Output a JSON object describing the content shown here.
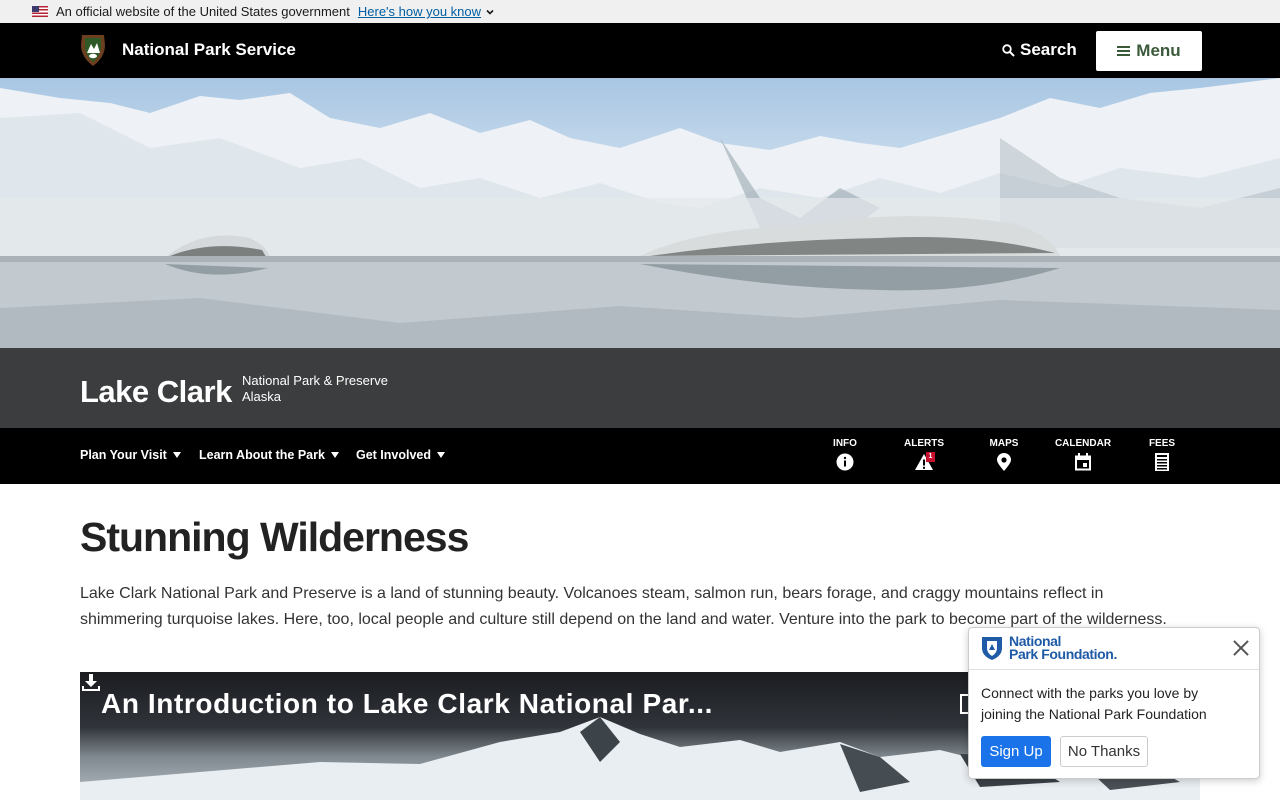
{
  "gov_banner": {
    "text": "An official website of the United States government",
    "link": "Here's how you know",
    "flag_icon": "us-flag-icon"
  },
  "header": {
    "site_name": "National Park Service",
    "search_label": "Search",
    "menu_label": "Menu"
  },
  "hero": {
    "park_name": "Lake Clark",
    "designation": "National Park & Preserve",
    "state": "Alaska"
  },
  "park_nav": {
    "items": [
      {
        "label": "Plan Your Visit"
      },
      {
        "label": "Learn About the Park"
      },
      {
        "label": "Get Involved"
      }
    ],
    "quick_links": [
      {
        "label": "INFO",
        "icon": "info-icon"
      },
      {
        "label": "ALERTS",
        "icon": "alert-icon",
        "badge": "1"
      },
      {
        "label": "MAPS",
        "icon": "map-pin-icon"
      },
      {
        "label": "CALENDAR",
        "icon": "calendar-icon"
      },
      {
        "label": "FEES",
        "icon": "fees-icon"
      }
    ]
  },
  "main": {
    "title": "Stunning Wilderness",
    "intro": "Lake Clark National Park and Preserve is a land of stunning beauty. Volcanoes steam, salmon run, bears forage, and craggy mountains reflect in shimmering turquoise lakes. Here, too, local people and culture still depend on the land and water. Venture into the park to become part of the wilderness.",
    "video_title": "An Introduction to Lake Clark National Par..."
  },
  "popup": {
    "logo_line1": "National",
    "logo_line2": "Park Foundation.",
    "message": "Connect with the parks you love by joining the National Park Foundation",
    "signup_label": "Sign Up",
    "no_thanks_label": "No Thanks"
  },
  "colors": {
    "header_bg": "#000000",
    "menu_text": "#3b5a3a",
    "link_blue": "#005ea2",
    "signup_blue": "#1a73e8",
    "npf_blue": "#1f5ba6",
    "alert_red": "#c8102e"
  }
}
